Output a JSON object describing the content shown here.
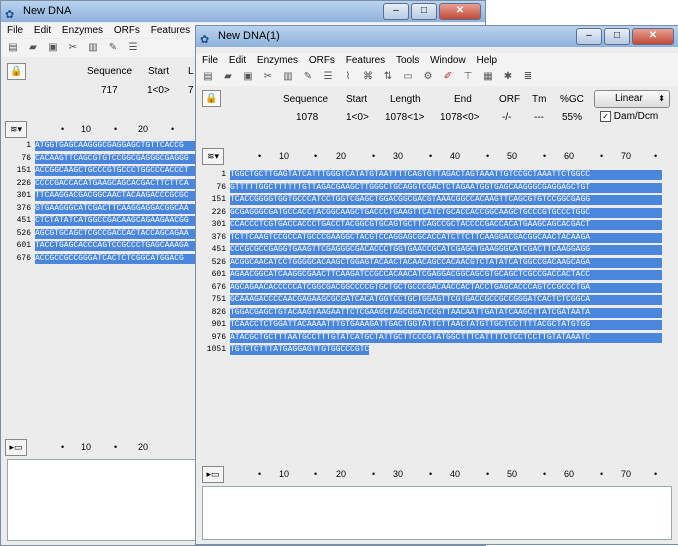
{
  "windows": {
    "back": {
      "title": "New DNA",
      "menu": [
        "File",
        "Edit",
        "Enzymes",
        "ORFs",
        "Features"
      ],
      "headers": [
        "Sequence",
        "Start",
        "L"
      ],
      "values": [
        "717",
        "1<0>",
        "7"
      ],
      "ruler": [
        "10",
        "20"
      ],
      "bottom_ruler": [
        "10",
        "20"
      ],
      "rows": [
        {
          "n": "1",
          "s": "ATGGTGAGCAAGGGCGAGGAGCTGTTCACCG"
        },
        {
          "n": "76",
          "s": "CACAAGTTCAGCGTGTCCGGCGAGGGCGAGGG"
        },
        {
          "n": "151",
          "s": "ACCGGCAAGCTGCCCGTGCCCTGGCCCACCCT"
        },
        {
          "n": "226",
          "s": "CCCCGACCACATGAAGCAGCACGACTTCTTCA"
        },
        {
          "n": "301",
          "s": "TTCAAGGACGACGGCAACTACAAGACCCGCGC"
        },
        {
          "n": "376",
          "s": "GTGAAGGGCATCGACTTCAAGGAGGACGGCAA"
        },
        {
          "n": "451",
          "s": "CTCTATATCATGGCCGACAAGCAGAAGAACGG"
        },
        {
          "n": "526",
          "s": "AGCGTGCAGCTCGCCGACCACTACCAGCAGAA"
        },
        {
          "n": "601",
          "s": "TACCTGAGCACCCAGTCCGCCCTGAGCAAAGA"
        },
        {
          "n": "676",
          "s": "ACCGCCGCCGGGATCACTCTCGGCATGGACG"
        }
      ]
    },
    "front": {
      "title": "New DNA(1)",
      "menu": [
        "File",
        "Edit",
        "Enzymes",
        "ORFs",
        "Features",
        "Tools",
        "Window",
        "Help"
      ],
      "info_headers": [
        "Sequence",
        "Start",
        "Length",
        "End",
        "ORF",
        "Tm",
        "%GC"
      ],
      "info_values": [
        "1078",
        "1<0>",
        "1078<1>",
        "1078<0>",
        "-/-",
        "---",
        "55%"
      ],
      "topology": "Linear",
      "dam_dcm": "Dam/Dcm",
      "ruler": [
        "10",
        "20",
        "30",
        "40",
        "50",
        "60",
        "70"
      ],
      "bottom_ruler": [
        "10",
        "20",
        "30",
        "40",
        "50",
        "60",
        "70"
      ],
      "rows": [
        {
          "n": "1",
          "s": "TGGCTGCTTGAGTATCATTTGGGTCATATGTAATTTTCAGTGTTAGACTAGTAAATTGTCCGCTAAATTCTGGCC"
        },
        {
          "n": "76",
          "s": "GTTTTTGGCTTTTTTGTTAGACGAAGCTTGGGCTGCAGGTCGACTCTAGAATGGTGAGCAAGGGCGAGGAGCTGT"
        },
        {
          "n": "151",
          "s": "TCACCGGGGTGGTGCCCATCCTGGTCGAGCTGGACGGCGACGTAAACGGCCACAAGTTCAGCGTGTCCGGCGAGG"
        },
        {
          "n": "226",
          "s": "GCGAGGGCGATGCCACCTACGGCAAGCTGACCCTGAAGTTCATCTGCACCACCGGCAAGCTGCCCGTGCCCTGGC"
        },
        {
          "n": "301",
          "s": "CCACCCTCGTGACCACCCTGACCTACGGCGTGCAGTGCTTCAGCCGCTACCCCGACCACATGAAGCAGCACGACT"
        },
        {
          "n": "376",
          "s": "TCTTCAAGTCCGCCATGCCCGAAGGCTACGTCCAGGAGCGCACCATCTTCTTCAAGGACGACGGCAACTACAAGA"
        },
        {
          "n": "451",
          "s": "CCCGCGCCGAGGTGAAGTTCGAGGGCGACACCCTGGTGAACCGCATCGAGCTGAAGGGCATCGACTTCAAGGAGG"
        },
        {
          "n": "526",
          "s": "ACGGCAACATCCTGGGGCACAAGCTGGAGTACAACTACAACAGCCACAACGTCTATATCATGGCCGACAAGCAGA"
        },
        {
          "n": "601",
          "s": "AGAACGGCATCAAGGCGAACTTCAAGATCCGCCACAACATCGAGGACGGCAGCGTGCAGCTCGCCGACCACTACC"
        },
        {
          "n": "676",
          "s": "AGCAGAACACCCCCATCGGCGACGGCCCCGTGCTGCTGCCCGACAACCACTACCTGAGCACCCAGTCCGCCCTGA"
        },
        {
          "n": "751",
          "s": "GCAAAGACCCCAACGAGAAGCGCGATCACATGGTCCTGCTGGAGTTCGTGACCGCCGCCGGGATCACTCTCGGCA"
        },
        {
          "n": "826",
          "s": "TGGACGAGCTGTACAAGTAAGAATTCTCGAAGCTAGCGGATCCGTTAACAATTGATATCAAGCTTATCGATAATA"
        },
        {
          "n": "901",
          "s": "TCAACCTCTGGATTACAAAATTTGTGAAAGATTGACTGGTATTCTTAACTATGTTGCTCCTTTTACGCTATGTGG"
        },
        {
          "n": "976",
          "s": "ATACGCTGCTTTAATGCCTTTGTATCATGCTATTGCTTCCCGTATGGCTTTCATTTTCTCCTCCTTGTATAAATC"
        },
        {
          "n": "1051",
          "s": "TGTCTCTTTATGAGGAGTTGTGGCCCGTC"
        }
      ]
    }
  }
}
